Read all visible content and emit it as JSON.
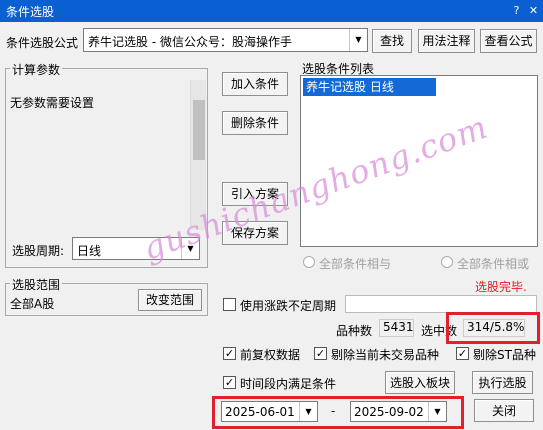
{
  "window": {
    "title": "条件选股",
    "help_btn": "?",
    "close_btn": "✕"
  },
  "formula": {
    "label": "条件选股公式",
    "value": "养牛记选股  -  微信公众号：股海操作手",
    "find_btn": "查找",
    "usage_btn": "用法注释",
    "view_btn": "查看公式"
  },
  "params": {
    "group_label": "计算参数",
    "no_params_text": "无参数需要设置",
    "period_label": "选股周期:",
    "period_value": "日线"
  },
  "condition_buttons": {
    "add": "加入条件",
    "delete": "删除条件",
    "import": "引入方案",
    "save": "保存方案"
  },
  "condition_list": {
    "label": "选股条件列表",
    "items": [
      "养牛记选股  日线"
    ]
  },
  "logic": {
    "and_label": "全部条件相与",
    "or_label": "全部条件相或"
  },
  "status_text": "选股完毕.",
  "range": {
    "group_label": "选股范围",
    "value": "全部A股",
    "change_btn": "改变范围"
  },
  "uncertain_period_label": "使用涨跌不定周期",
  "stats": {
    "count_label": "品种数",
    "count_value": "5431",
    "selected_label": "选中数",
    "selected_value": "314/5.8%"
  },
  "options": {
    "adjusted_label": "前复权数据",
    "exclude_untraded_label": "剔除当前未交易品种",
    "exclude_st_label": "剔除ST品种",
    "time_period_label": "时间段内满足条件"
  },
  "actions": {
    "to_block_btn": "选股入板块",
    "execute_btn": "执行选股",
    "close_btn": "关闭"
  },
  "dates": {
    "start": "2025-06-01",
    "separator": "-",
    "end": "2025-09-02"
  },
  "watermark_text": "gushichanghong.com",
  "colors": {
    "titlebar": "#0a5fd3",
    "selection": "#1569d6",
    "status": "#e0202a",
    "highlight_box": "#e0202a"
  }
}
